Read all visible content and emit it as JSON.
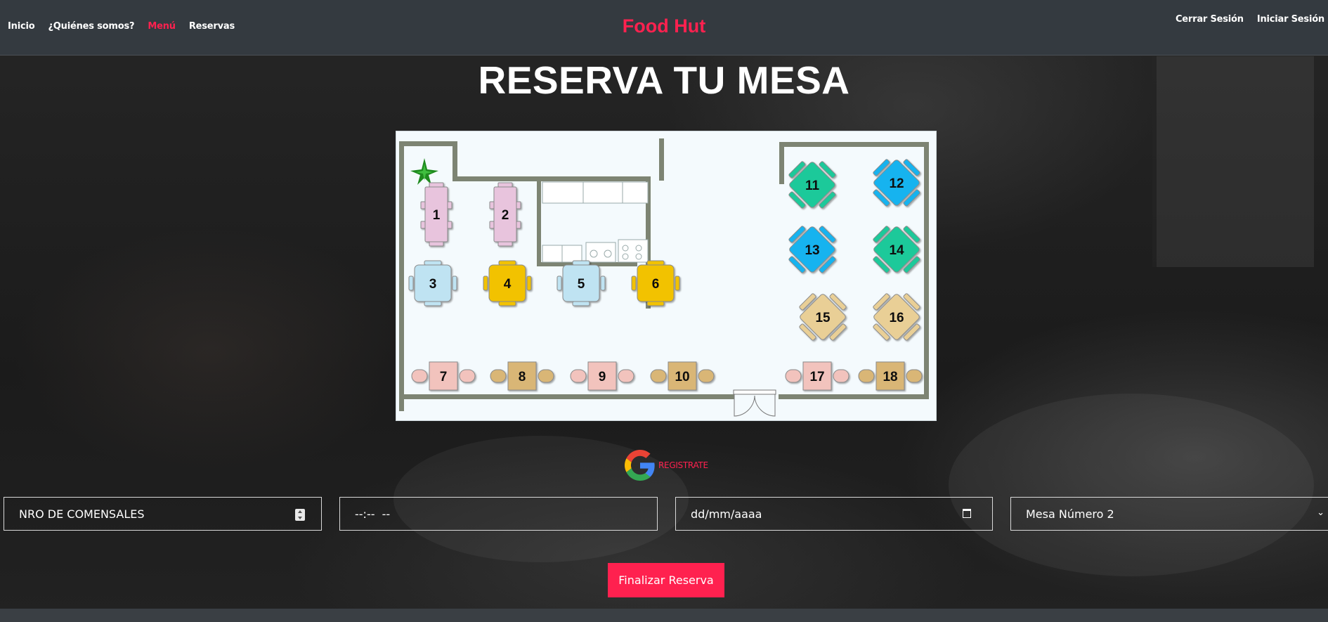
{
  "nav": {
    "items": [
      {
        "label": "Inicio",
        "active": false
      },
      {
        "label": "¿Quiénes somos?",
        "active": false
      },
      {
        "label": "Menú",
        "active": true
      },
      {
        "label": "Reservas",
        "active": false
      }
    ],
    "brand": "Food Hut",
    "right": [
      {
        "label": "Cerrar Sesión"
      },
      {
        "label": "Iniciar Sesión"
      }
    ]
  },
  "title": "RESERVA TU MESA",
  "floorplan": {
    "tables": [
      "1",
      "2",
      "3",
      "4",
      "5",
      "6",
      "7",
      "8",
      "9",
      "10",
      "11",
      "12",
      "13",
      "14",
      "15",
      "16",
      "17",
      "18"
    ]
  },
  "register": {
    "label": "REGISTRATE",
    "icon": "google-icon"
  },
  "form": {
    "guests_placeholder": "NRO DE COMENSALES",
    "time_value": "--:--  --",
    "date_value": "dd/mm/aaaa",
    "table_select_value": "Mesa Número 2",
    "submit_label": "Finalizar Reserva"
  },
  "colors": {
    "accent": "#ff214f",
    "navbar": "#343a40",
    "wall": "#7d8473",
    "table_pink": "#e8c4dd",
    "table_lightblue": "#bfe3f2",
    "table_yellow": "#f2c200",
    "table_salmon": "#f2c3bd",
    "table_tan": "#d9b676",
    "table_teal": "#1dc99a",
    "table_blue": "#14b3ef",
    "table_beige": "#e9cf96"
  }
}
